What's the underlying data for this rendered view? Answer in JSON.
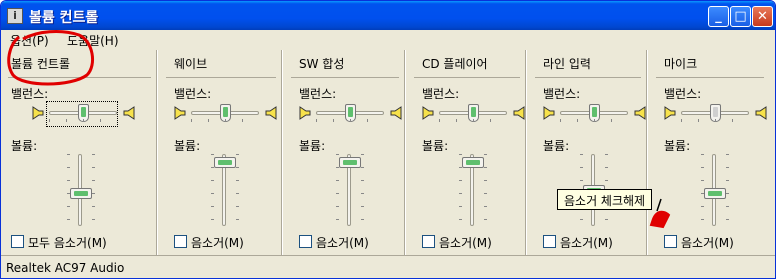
{
  "window": {
    "title": "볼륨 컨트롤",
    "minimize_symbol": "_",
    "maximize_symbol": "□",
    "close_symbol": "✕"
  },
  "menu": {
    "options": "옵션(P)",
    "help": "도움말(H)"
  },
  "columns": [
    {
      "header": "볼륨 컨트롤",
      "balance_label": "밸런스:",
      "volume_label": "볼륨:",
      "mute_label": "모두 음소거(M)",
      "balance": 0.5,
      "volume": 0.45,
      "muted": false
    },
    {
      "header": "웨이브",
      "balance_label": "밸런스:",
      "volume_label": "볼륨:",
      "mute_label": "음소거(M)",
      "balance": 0.5,
      "volume": 0.95,
      "muted": false
    },
    {
      "header": "SW 합성",
      "balance_label": "밸런스:",
      "volume_label": "볼륨:",
      "mute_label": "음소거(M)",
      "balance": 0.5,
      "volume": 0.95,
      "muted": false
    },
    {
      "header": "CD 플레이어",
      "balance_label": "밸런스:",
      "volume_label": "볼륨:",
      "mute_label": "음소거(M)",
      "balance": 0.5,
      "volume": 0.95,
      "muted": false
    },
    {
      "header": "라인 입력",
      "balance_label": "밸런스:",
      "volume_label": "볼륨:",
      "mute_label": "음소거(M)",
      "balance": 0.5,
      "volume": 0.5,
      "muted": false
    },
    {
      "header": "마이크",
      "balance_label": "밸런스:",
      "volume_label": "볼륨:",
      "mute_label": "음소거(M)",
      "balance": 0.5,
      "volume": 0.45,
      "muted": false,
      "balance_disabled": true
    }
  ],
  "tooltip": "음소거 체크해제",
  "status": "Realtek AC97 Audio",
  "colors": {
    "titlebar": "#0053ee",
    "annotation": "#e00000",
    "slider_thumb_accent": "#5fbf6e"
  },
  "icons": [
    "app-icon",
    "speaker-icon"
  ]
}
